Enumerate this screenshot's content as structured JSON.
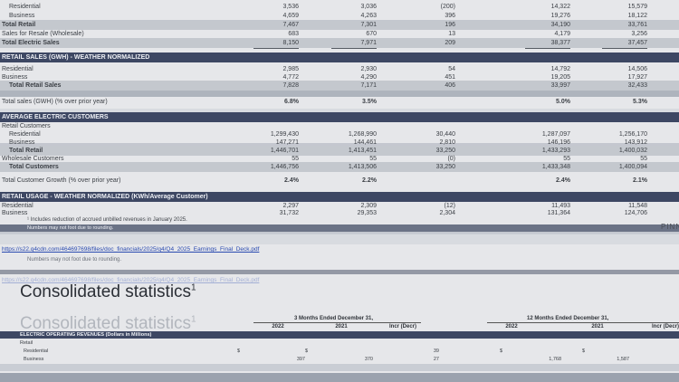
{
  "top": {
    "residential_label": "Residential",
    "residential": [
      "3,536",
      "3,036",
      "(200)",
      "14,322",
      "15,579"
    ],
    "business_label": "Business",
    "business": [
      "4,659",
      "4,263",
      "396",
      "19,276",
      "18,122"
    ],
    "total_retail_label": "Total Retail",
    "total_retail": [
      "7,467",
      "7,301",
      "196",
      "34,190",
      "33,761"
    ],
    "wholesale_label": "Sales for Resale (Wholesale)",
    "wholesale": [
      "683",
      "670",
      "13",
      "4,179",
      "3,256"
    ],
    "total_electric_label": "Total Electric Sales",
    "total_electric": [
      "8,150",
      "7,971",
      "209",
      "38,377",
      "37,457"
    ]
  },
  "weather_normalized": {
    "band": "RETAIL SALES (GWH) - WEATHER NORMALIZED",
    "rows": [
      {
        "label": "Residential",
        "values": [
          "2,985",
          "2,930",
          "54",
          "14,792",
          "14,506"
        ]
      },
      {
        "label": "Business",
        "values": [
          "4,772",
          "4,290",
          "451",
          "19,205",
          "17,927"
        ]
      }
    ],
    "total_label": "Total Retail Sales",
    "total_values": [
      "7,828",
      "7,171",
      "406",
      "33,997",
      "32,433"
    ],
    "growth_label": "Total sales (GWH) (% over prior year)",
    "growth_values": [
      "6.8%",
      "3.5%",
      "",
      "5.0%",
      "5.3%"
    ]
  },
  "customers": {
    "band": "AVERAGE ELECTRIC CUSTOMERS",
    "retail_label": "Retail Customers",
    "rows": [
      {
        "label": "Residential",
        "values": [
          "1,299,430",
          "1,268,990",
          "30,440",
          "1,287,097",
          "1,256,170"
        ]
      },
      {
        "label": "Business",
        "values": [
          "147,271",
          "144,461",
          "2,810",
          "146,196",
          "143,912"
        ]
      }
    ],
    "total_retail_label": "Total Retail",
    "total_retail_values": [
      "1,446,701",
      "1,413,451",
      "33,250",
      "1,433,293",
      "1,400,032"
    ],
    "wholesale_label": "Wholesale Customers",
    "wholesale_values": [
      "55",
      "55",
      "(0)",
      "55",
      "55"
    ],
    "total_label": "Total Customers",
    "total_values": [
      "1,446,756",
      "1,413,506",
      "33,250",
      "1,433,348",
      "1,400,094"
    ],
    "growth_label": "Total Customer Growth (% over prior year)",
    "growth_values": [
      "2.4%",
      "2.2%",
      "",
      "2.4%",
      "2.1%"
    ]
  },
  "usage": {
    "band": "RETAIL USAGE - WEATHER NORMALIZED (KWh/Average Customer)",
    "rows": [
      {
        "label": "Residential",
        "values": [
          "2,297",
          "2,309",
          "(12)",
          "11,493",
          "11,548"
        ]
      },
      {
        "label": "Business",
        "values": [
          "31,732",
          "29,353",
          "2,304",
          "131,364",
          "124,706"
        ]
      }
    ],
    "footnote1": "Includes reduction of accrued unbilled revenues in January 2025.",
    "footnote2": "Numbers may not foot due to rounding."
  },
  "link_text": "https://s22.q4cdn.com/464697698/files/doc_financials/2025/q4/Q4_2025_Earnings_Final_Deck.pdf",
  "note_text": "Numbers may not foot due to rounding.",
  "logo_text": "PINNA",
  "consolidated": {
    "title": "Consolidated statistics",
    "title_sup": "1",
    "group_3m": "3 Months Ended December 31,",
    "group_12m": "12 Months Ended December 31,",
    "years": [
      "2022",
      "2021",
      "Incr (Decr)"
    ],
    "band": "ELECTRIC OPERATING REVENUES (Dollars in Millions)",
    "retail_label": "Retail",
    "rows": [
      {
        "label": "Residential",
        "values": [
          "$",
          "",
          "$",
          "",
          "39",
          "$",
          "",
          "$",
          "",
          ""
        ]
      },
      {
        "label": "Business",
        "values": [
          "",
          "397",
          "",
          "370",
          "27",
          "",
          "1,768",
          "",
          "1,587",
          ""
        ]
      }
    ]
  }
}
